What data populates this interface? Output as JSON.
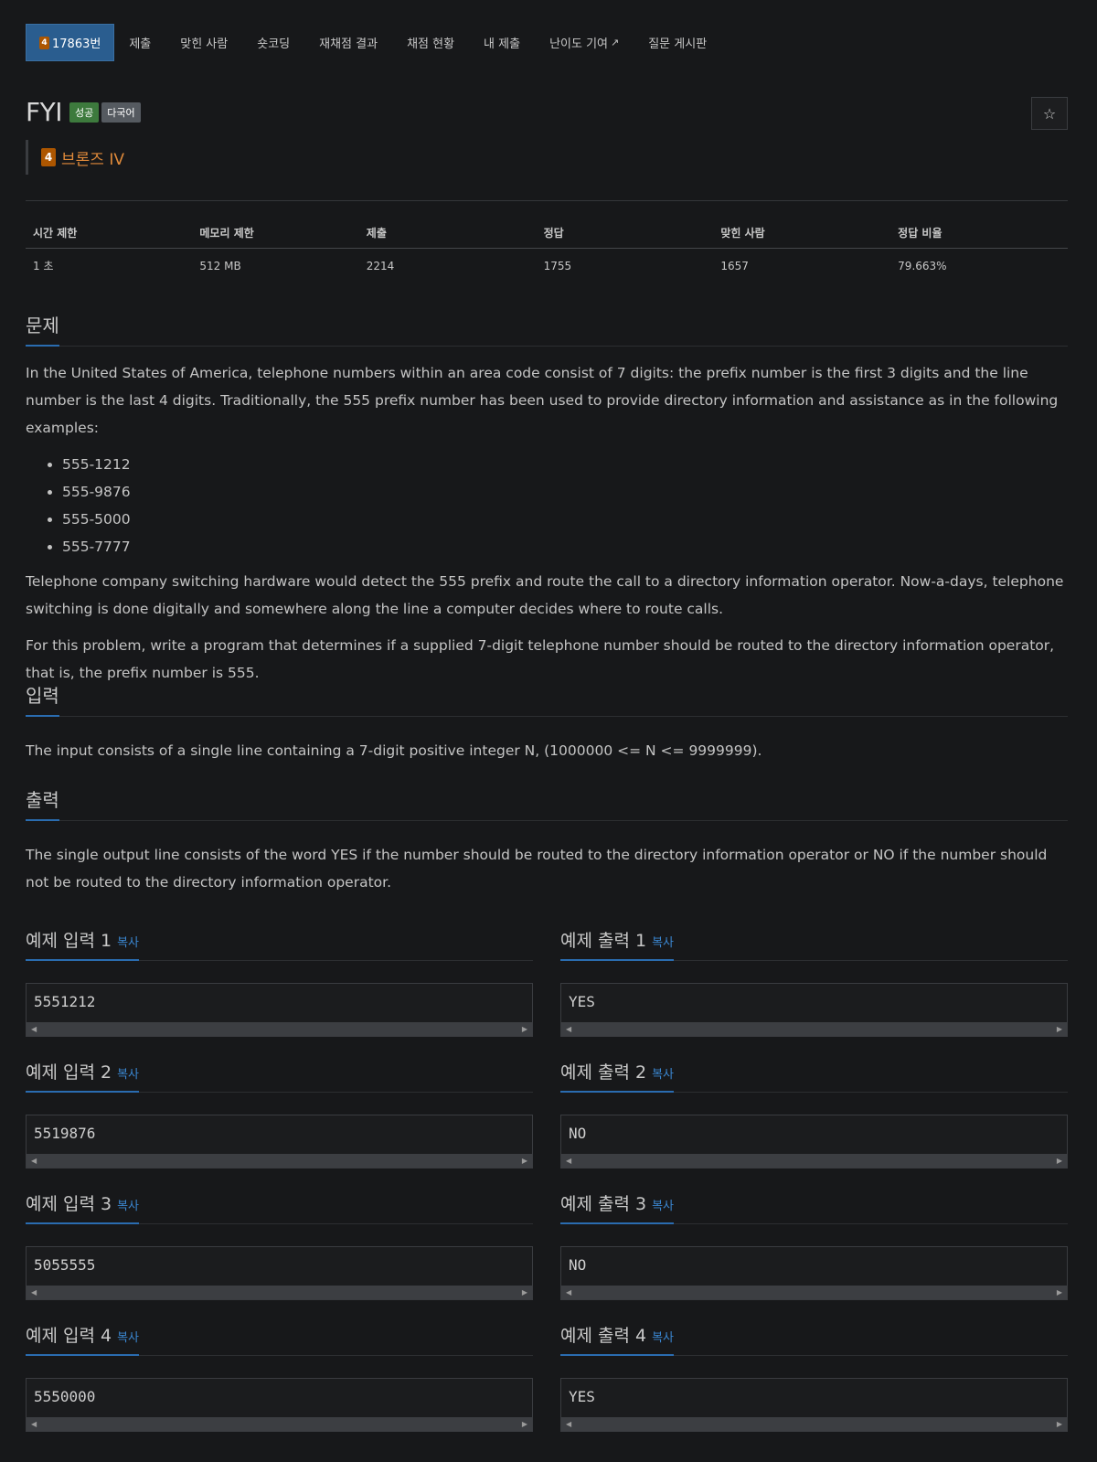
{
  "nav": {
    "tier_badge": "4",
    "items": [
      "17863번",
      "제출",
      "맞힌 사람",
      "숏코딩",
      "재채점 결과",
      "채점 현황",
      "내 제출",
      "난이도 기여",
      "질문 게시판"
    ]
  },
  "problem": {
    "title": "FYI",
    "labels": [
      "성공",
      "다국어"
    ],
    "tier_badge": "4",
    "tier": "브론즈 IV"
  },
  "stats": {
    "headers": [
      "시간 제한",
      "메모리 제한",
      "제출",
      "정답",
      "맞힌 사람",
      "정답 비율"
    ],
    "values": [
      "1 초",
      "512 MB",
      "2214",
      "1755",
      "1657",
      "79.663%"
    ]
  },
  "description": {
    "heading": "문제",
    "p1": "In the United States of America, telephone numbers within an area code consist of 7 digits: the prefix number is the first 3 digits and the line number is the last 4 digits. Traditionally, the 555 prefix number has been used to provide directory information and assistance as in the following examples:",
    "examples": [
      "555-1212",
      "555-9876",
      "555-5000",
      "555-7777"
    ],
    "p2": "Telephone company switching hardware would detect the 555 prefix and route the call to a directory information operator. Now-a-days, telephone switching is done digitally and somewhere along the line a computer decides where to route calls.",
    "p3": "For this problem, write a program that determines if a supplied 7-digit telephone number should be routed to the directory information operator, that is, the prefix number is 555."
  },
  "input": {
    "heading": "입력",
    "text": "The input consists of a single line containing a 7-digit positive integer N, (1000000 <= N <= 9999999)."
  },
  "output": {
    "heading": "출력",
    "text": "The single output line consists of the word YES if the number should be routed to the directory information operator or NO if the number should not be routed to the directory information operator."
  },
  "copy_label": "복사",
  "samples": [
    {
      "in_title": "예제 입력 1",
      "in": "5551212",
      "out_title": "예제 출력 1",
      "out": "YES"
    },
    {
      "in_title": "예제 입력 2",
      "in": "5519876",
      "out_title": "예제 출력 2",
      "out": "NO"
    },
    {
      "in_title": "예제 입력 3",
      "in": "5055555",
      "out_title": "예제 출력 3",
      "out": "NO"
    },
    {
      "in_title": "예제 입력 4",
      "in": "5550000",
      "out_title": "예제 출력 4",
      "out": "YES"
    }
  ],
  "icons": {
    "star": "star-icon",
    "external": "external-link-icon",
    "scroll": "scroll-arrow-icon"
  },
  "colors": {
    "background": "#17181a",
    "accent": "#2a6cb0",
    "active_tab": "#2a5d8f",
    "bronze": "#ad5600",
    "success": "#3d7a3d"
  }
}
